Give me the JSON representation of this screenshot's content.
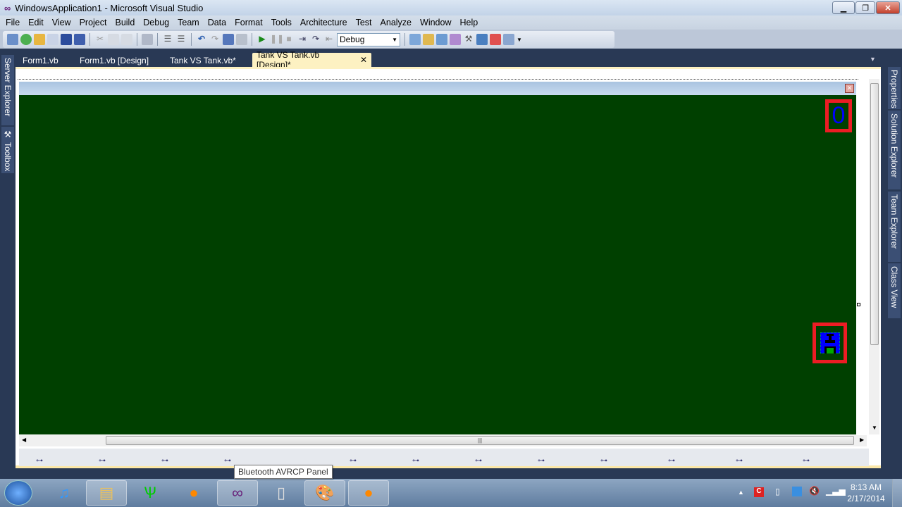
{
  "window": {
    "title": "WindowsApplication1 - Microsoft Visual Studio",
    "icon": "visual-studio-infinity-icon"
  },
  "menu": [
    "File",
    "Edit",
    "View",
    "Project",
    "Build",
    "Debug",
    "Team",
    "Data",
    "Format",
    "Tools",
    "Architecture",
    "Test",
    "Analyze",
    "Window",
    "Help"
  ],
  "toolbar": {
    "config": "Debug"
  },
  "tabs": [
    {
      "label": "Form1.vb"
    },
    {
      "label": "Form1.vb [Design]"
    },
    {
      "label": "Tank VS Tank.vb*"
    },
    {
      "label": "Tank VS Tank.vb [Design]*",
      "active": true
    }
  ],
  "left_panels": [
    "Server Explorer",
    "Toolbox"
  ],
  "right_panels": [
    "Properties",
    "Solution Explorer",
    "Team Explorer",
    "Class View"
  ],
  "form": {
    "back_color": "#004000",
    "score_label": "0",
    "label_color": "#0000ff",
    "border_color": "#ed1c24"
  },
  "tooltip": "Bluetooth AVRCP Panel",
  "taskbar": {
    "time": "8:13 AM",
    "date": "2/17/2014"
  }
}
